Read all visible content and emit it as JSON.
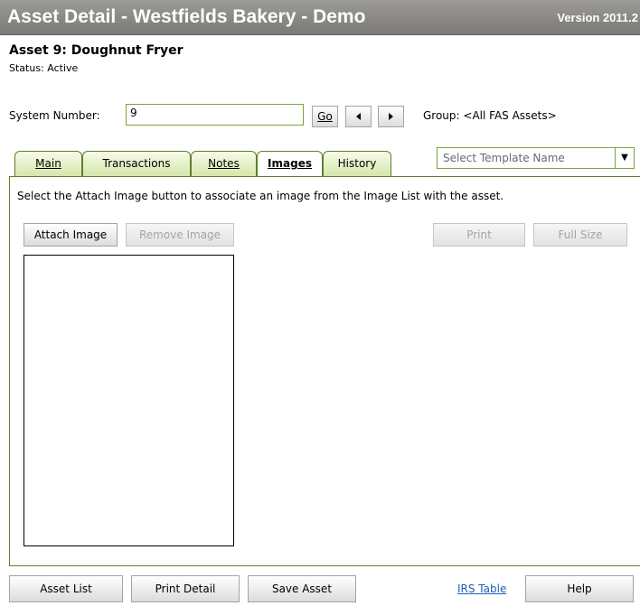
{
  "window": {
    "title": "Asset Detail - Westfields Bakery - Demo",
    "version": "Version 2011.2"
  },
  "asset": {
    "title": "Asset 9: Doughnut Fryer",
    "status": "Status: Active"
  },
  "system_number": {
    "label": "System Number:",
    "value": "9",
    "go_label": "Go",
    "prev_icon": "triangle-left",
    "next_icon": "triangle-right",
    "group": "Group: <All FAS Assets>"
  },
  "tabs": [
    {
      "label": "Main",
      "active": false
    },
    {
      "label": "Transactions",
      "active": false
    },
    {
      "label": "Notes",
      "active": false
    },
    {
      "label": "Images",
      "active": true
    },
    {
      "label": "History",
      "active": false
    }
  ],
  "template_select": {
    "placeholder": "Select Template Name"
  },
  "images_tab": {
    "instruction": "Select the Attach Image button to associate an image from the Image List with the asset.",
    "attach_label": "Attach Image",
    "remove_label": "Remove Image",
    "print_label": "Print",
    "fullsize_label": "Full Size"
  },
  "footer": {
    "asset_list": "Asset List",
    "print_detail": "Print Detail",
    "save_asset": "Save Asset",
    "irs_table": "IRS Table",
    "help": "Help"
  },
  "colors": {
    "title_bar": "#8c8a86",
    "tab_border": "#5f7f2e",
    "tab_fill": "#d4e6a8",
    "link": "#1a5fb4"
  }
}
